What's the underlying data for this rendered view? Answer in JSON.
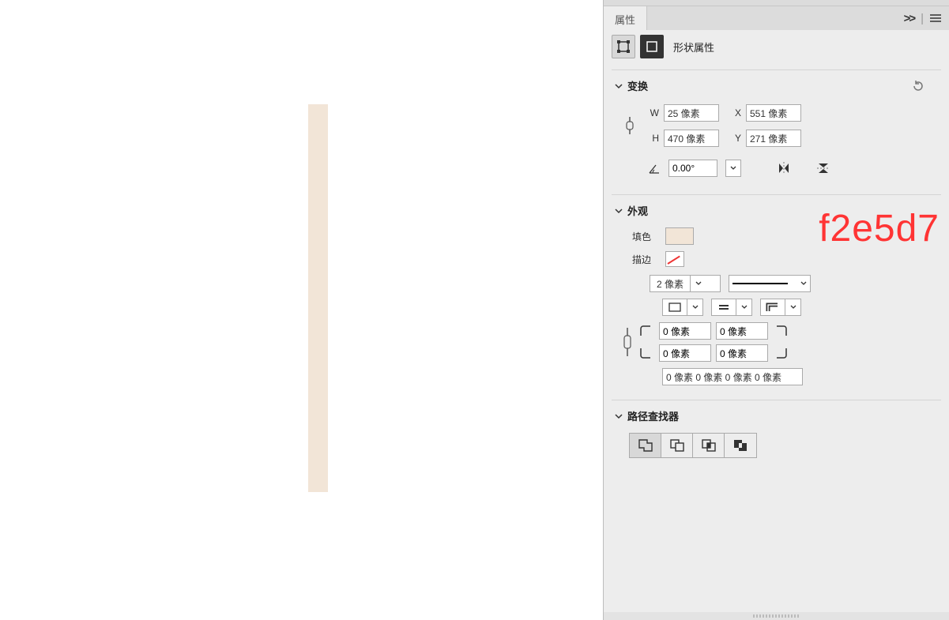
{
  "panel": {
    "tab_label": "属性",
    "shape_props_label": "形状属性",
    "expand_glyph": ">>"
  },
  "transform": {
    "title": "变换",
    "w_label": "W",
    "h_label": "H",
    "x_label": "X",
    "y_label": "Y",
    "w_value": "25 像素",
    "h_value": "470 像素",
    "x_value": "551 像素",
    "y_value": "271 像素",
    "angle_value": "0.00°"
  },
  "appearance": {
    "title": "外观",
    "fill_label": "填色",
    "stroke_label": "描边",
    "fill_hex": "f2e5d7",
    "stroke_width": "2 像素",
    "radius_tl": "0 像素",
    "radius_tr": "0 像素",
    "radius_bl": "0 像素",
    "radius_br": "0 像素",
    "radius_summary": "0 像素 0 像素 0 像素 0 像素"
  },
  "pathfinder": {
    "title": "路径查找器"
  },
  "hex_overlay": "f2e5d7"
}
